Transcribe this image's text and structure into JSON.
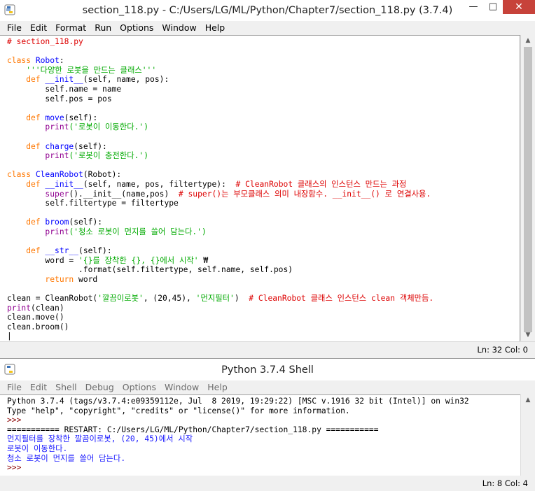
{
  "editor": {
    "title": "section_118.py - C:/Users/LG/ML/Python/Chapter7/section_118.py (3.7.4)",
    "menu": [
      "File",
      "Edit",
      "Format",
      "Run",
      "Options",
      "Window",
      "Help"
    ],
    "status": "Ln: 32  Col: 0",
    "lines": [
      [
        [
          "cmt",
          "# section_118.py"
        ]
      ],
      [],
      [
        [
          "kw",
          "class "
        ],
        [
          "def",
          "Robot"
        ],
        [
          "txt",
          ":"
        ]
      ],
      [
        [
          "str",
          "    '''다양한 로봇을 만드는 클래스'''"
        ]
      ],
      [
        [
          "kw",
          "    def "
        ],
        [
          "def",
          "__init__"
        ],
        [
          "txt",
          "(self, name, pos):"
        ]
      ],
      [
        [
          "txt",
          "        self.name = name"
        ]
      ],
      [
        [
          "txt",
          "        self.pos = pos"
        ]
      ],
      [],
      [
        [
          "kw",
          "    def "
        ],
        [
          "def",
          "move"
        ],
        [
          "txt",
          "(self):"
        ]
      ],
      [
        [
          "txt",
          "        "
        ],
        [
          "bi",
          "print"
        ],
        [
          "str",
          "('로봇이 이동한다.')"
        ]
      ],
      [],
      [
        [
          "kw",
          "    def "
        ],
        [
          "def",
          "charge"
        ],
        [
          "txt",
          "(self):"
        ]
      ],
      [
        [
          "txt",
          "        "
        ],
        [
          "bi",
          "print"
        ],
        [
          "str",
          "('로봇이 충전한다.')"
        ]
      ],
      [],
      [
        [
          "kw",
          "class "
        ],
        [
          "def",
          "CleanRobot"
        ],
        [
          "txt",
          "(Robot):"
        ]
      ],
      [
        [
          "kw",
          "    def "
        ],
        [
          "def",
          "__init__"
        ],
        [
          "txt",
          "(self, name, pos, filtertype):  "
        ],
        [
          "cmt",
          "# CleanRobot 클래스의 인스턴스 만드는 과정"
        ]
      ],
      [
        [
          "txt",
          "        "
        ],
        [
          "bi",
          "super"
        ],
        [
          "txt",
          "().__init__(name,pos)  "
        ],
        [
          "cmt",
          "# super()는 부모클래스 의미 내장함수. __init__() 로 연결사용."
        ]
      ],
      [
        [
          "txt",
          "        self.filtertype = filtertype"
        ]
      ],
      [],
      [
        [
          "kw",
          "    def "
        ],
        [
          "def",
          "broom"
        ],
        [
          "txt",
          "(self):"
        ]
      ],
      [
        [
          "txt",
          "        "
        ],
        [
          "bi",
          "print"
        ],
        [
          "str",
          "('청소 로봇이 먼지를 쓸어 담는다.')"
        ]
      ],
      [],
      [
        [
          "kw",
          "    def "
        ],
        [
          "def",
          "__str__"
        ],
        [
          "txt",
          "(self):"
        ]
      ],
      [
        [
          "txt",
          "        word = "
        ],
        [
          "str",
          "'{}를 장착한 {}, {}에서 시작'"
        ],
        [
          "txt",
          " ₩"
        ]
      ],
      [
        [
          "txt",
          "               .format(self.filtertype, self.name, self.pos)"
        ]
      ],
      [
        [
          "kw",
          "        return "
        ],
        [
          "txt",
          "word"
        ]
      ],
      [],
      [
        [
          "txt",
          "clean = CleanRobot("
        ],
        [
          "str",
          "'깔끔이로봇'"
        ],
        [
          "txt",
          ", (20,45), "
        ],
        [
          "str",
          "'먼지필터'"
        ],
        [
          "txt",
          ")  "
        ],
        [
          "cmt",
          "# CleanRobot 클래스 인스턴스 clean 객체만듬."
        ]
      ],
      [
        [
          "bi",
          "print"
        ],
        [
          "txt",
          "(clean)"
        ]
      ],
      [
        [
          "txt",
          "clean.move()"
        ]
      ],
      [
        [
          "txt",
          "clean.broom()"
        ]
      ],
      [
        [
          "txt",
          "|"
        ]
      ]
    ]
  },
  "shell": {
    "title": "Python 3.7.4 Shell",
    "menu": [
      "File",
      "Edit",
      "Shell",
      "Debug",
      "Options",
      "Window",
      "Help"
    ],
    "status": "Ln: 8  Col: 4",
    "lines": [
      [
        [
          "txt",
          "Python 3.7.4 (tags/v3.7.4:e09359112e, Jul  8 2019, 19:29:22) [MSC v.1916 32 bit (Intel)] on win32"
        ]
      ],
      [
        [
          "txt",
          "Type \"help\", \"copyright\", \"credits\" or \"license()\" for more information."
        ]
      ],
      [
        [
          "prompt",
          ">>> "
        ]
      ],
      [
        [
          "restart",
          "=========== RESTART: C:/Users/LG/ML/Python/Chapter7/section_118.py ==========="
        ]
      ],
      [
        [
          "blu",
          "먼지필터를 장착한 깔끔이로봇, (20, 45)에서 시작"
        ]
      ],
      [
        [
          "blu",
          "로봇이 이동한다."
        ]
      ],
      [
        [
          "blu",
          "청소 로봇이 먼지를 쓸어 담는다."
        ]
      ],
      [
        [
          "prompt",
          ">>> "
        ]
      ]
    ]
  },
  "icons": {
    "app": "python-idle-icon",
    "minimize": "minimize-icon",
    "maximize": "maximize-icon",
    "close": "close-icon"
  }
}
